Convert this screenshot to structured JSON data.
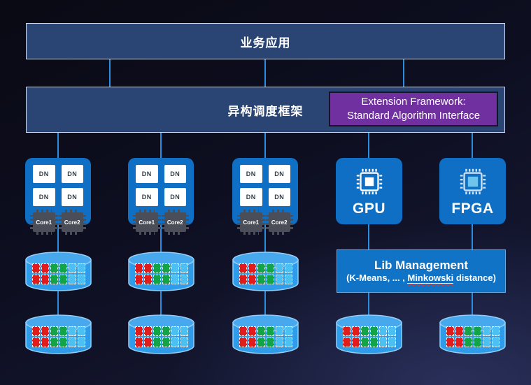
{
  "colors": {
    "line": "#2b8de0",
    "bar_fill": "#2a4473",
    "bar_border": "#ccd8ea",
    "purple_fill": "#7030a0",
    "purple_border": "#15152a",
    "device_fill": "#0e6fc5",
    "lib_fill": "#1173c5",
    "lib_border": "#69a8dc",
    "dn_fill": "#ffffff",
    "dn_text": "#323c46",
    "chip_fill": "#4a4e58",
    "cyl_fill": "#2f9ce9",
    "cyl_top_fill": "#47a8ee",
    "cyl_border": "#95cdf6"
  },
  "top_bar": {
    "label": "业务应用"
  },
  "framework_bar": {
    "label": "异构调度框架"
  },
  "extension_box": {
    "line1": "Extension Framework:",
    "line2": "Standard Algorithm Interface"
  },
  "nodes": [
    {
      "dn": [
        "DN",
        "DN",
        "DN",
        "DN"
      ],
      "cores": [
        "Core1",
        "Core2"
      ]
    },
    {
      "dn": [
        "DN",
        "DN",
        "DN",
        "DN"
      ],
      "cores": [
        "Core1",
        "Core2"
      ]
    },
    {
      "dn": [
        "DN",
        "DN",
        "DN",
        "DN"
      ],
      "cores": [
        "Core1",
        "Core2"
      ]
    }
  ],
  "gpu": {
    "label": "GPU"
  },
  "fpga": {
    "label": "FPGA"
  },
  "lib_box": {
    "title": "Lib Management",
    "sub_prefix": "(K-Means, ... , ",
    "sub_word": "Minkowski",
    "sub_suffix": " distance)"
  },
  "cylinder": {
    "rows": 2,
    "block_colors": [
      "#e01c1c",
      "#e01c1c",
      "#12a447",
      "#12a447",
      "#4cc0f0",
      "#4cc0f0"
    ]
  }
}
